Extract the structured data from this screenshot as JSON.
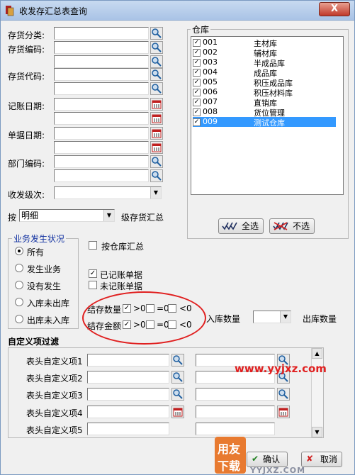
{
  "window": {
    "title": "收发存汇总表查询",
    "close": "X"
  },
  "filters": {
    "inventory_category": "存货分类:",
    "inventory_code": "存货编码:",
    "inventory_code2": "存货代码:",
    "posting_date": "记账日期:",
    "doc_date": "单据日期:",
    "dept_code": "部门编码:",
    "level": "收发级次:"
  },
  "summary": {
    "by_label": "按",
    "by_value": "明细",
    "suffix": "级存货汇总"
  },
  "business_status": {
    "title": "业务发生状况",
    "options": [
      "所有",
      "发生业务",
      "没有发生",
      "入库未出库",
      "出库未入库"
    ],
    "selected": 0
  },
  "by_warehouse": "按仓库汇总",
  "posted_docs": "已记账单据",
  "unposted_docs": "未记账单据",
  "balance_qty": {
    "label": "结存数量",
    "gt": ">0",
    "eq": "=0",
    "lt": "<0"
  },
  "balance_amt": {
    "label": "结存金额",
    "gt": ">0",
    "eq": "=0",
    "lt": "<0"
  },
  "in_qty": "入库数量",
  "out_qty": "出库数量",
  "warehouse": {
    "title": "仓库",
    "items": [
      {
        "code": "001",
        "name": "主材库"
      },
      {
        "code": "002",
        "name": "辅材库"
      },
      {
        "code": "003",
        "name": "半成品库"
      },
      {
        "code": "004",
        "name": "成品库"
      },
      {
        "code": "005",
        "name": "积压成品库"
      },
      {
        "code": "006",
        "name": "积压材料库"
      },
      {
        "code": "007",
        "name": "直销库"
      },
      {
        "code": "008",
        "name": "货位管理"
      },
      {
        "code": "009",
        "name": "测试仓库"
      }
    ],
    "select_all": "全选",
    "deselect": "不选"
  },
  "custom_filter": {
    "title": "自定义项过滤",
    "rows": [
      "表头自定义项1",
      "表头自定义项2",
      "表头自定义项3",
      "表头自定义项4",
      "表头自定义项5"
    ]
  },
  "buttons": {
    "ok": "确认",
    "cancel": "取消"
  },
  "watermark": {
    "url": "www.yyjxz.com",
    "logo_top": "用友",
    "logo_bottom": "下载",
    "brand": "YYJXZ.COM"
  },
  "colors": {
    "selection": "#3399ff",
    "highlight_ellipse": "#e02020",
    "watermark": "#e02020"
  }
}
